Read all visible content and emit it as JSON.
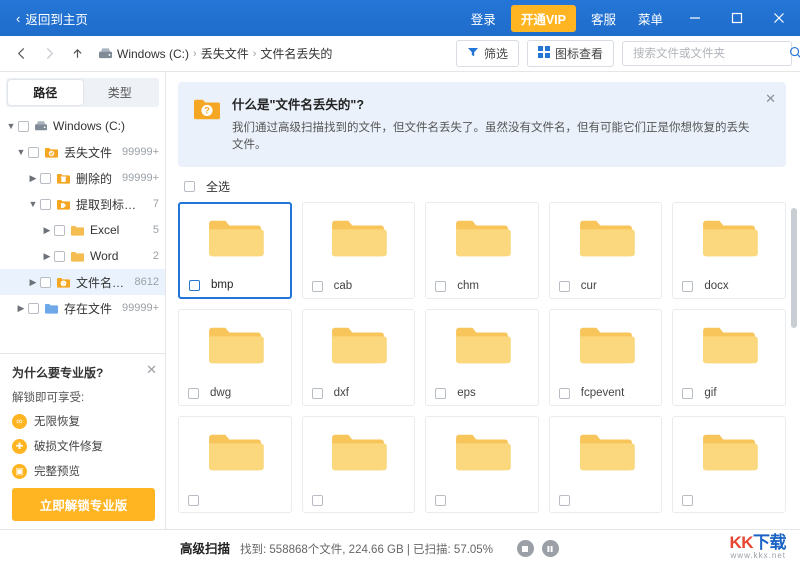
{
  "titlebar": {
    "back_label": "返回到主页",
    "back_icon": "chevron-left-icon",
    "menu": [
      {
        "label": "登录",
        "name": "login"
      },
      {
        "label": "客服",
        "name": "support"
      },
      {
        "label": "菜单",
        "name": "menu"
      }
    ],
    "vip_label": "开通VIP",
    "window_buttons": {
      "minimize": "minimize-icon",
      "maximize": "maximize-icon",
      "close": "close-icon"
    },
    "bg_color": "#2476d6",
    "vip_color": "#ffb422"
  },
  "navbar": {
    "back_icon": "arrow-left-icon",
    "forward_icon": "arrow-right-icon",
    "up_icon": "arrow-up-icon",
    "breadcrumb": [
      "Windows (C:)",
      "丢失文件",
      "文件名丢失的"
    ],
    "filter_label": "筛选",
    "view_label": "图标查看",
    "search_placeholder": "搜索文件或文件夹",
    "search_value": ""
  },
  "sidebar": {
    "tabs": [
      {
        "label": "路径",
        "active": true
      },
      {
        "label": "类型",
        "active": false
      }
    ],
    "tree": [
      {
        "label": "Windows (C:)",
        "count": "",
        "depth": 0,
        "caret": "▼",
        "icon": "drive-icon",
        "selected": false
      },
      {
        "label": "丢失文件",
        "count": "99999+",
        "depth": 1,
        "caret": "▼",
        "icon": "folder-orange-icon",
        "selected": false
      },
      {
        "label": "删除的",
        "count": "99999+",
        "depth": 2,
        "caret": "▶",
        "icon": "folder-recycle-icon",
        "selected": false
      },
      {
        "label": "提取到标签的",
        "count": "7",
        "depth": 2,
        "caret": "▼",
        "icon": "folder-tag-icon",
        "selected": false
      },
      {
        "label": "Excel",
        "count": "5",
        "depth": 3,
        "caret": "▶",
        "icon": "folder-icon",
        "selected": false
      },
      {
        "label": "Word",
        "count": "2",
        "depth": 3,
        "caret": "▶",
        "icon": "folder-icon",
        "selected": false
      },
      {
        "label": "文件名丢失的",
        "count": "8612",
        "depth": 2,
        "caret": "▶",
        "icon": "folder-question-icon",
        "selected": true
      },
      {
        "label": "存在文件",
        "count": "99999+",
        "depth": 1,
        "caret": "▶",
        "icon": "folder-blue-icon",
        "selected": false
      }
    ],
    "promo": {
      "title": "为什么要专业版?",
      "subtitle": "解锁即可享受:",
      "items": [
        {
          "label": "无限恢复",
          "icon": "unlimited-icon"
        },
        {
          "label": "破损文件修复",
          "icon": "repair-icon"
        },
        {
          "label": "完整预览",
          "icon": "preview-icon"
        }
      ],
      "button_label": "立即解锁专业版",
      "close_icon": "close-icon"
    }
  },
  "notice": {
    "icon": "folder-question-icon",
    "title": "什么是\"文件名丢失的\"?",
    "text": "我们通过高级扫描找到的文件，但文件名丢失了。虽然没有文件名，但有可能它们正是你想恢复的丢失文件。",
    "close_icon": "close-icon"
  },
  "content": {
    "select_all_label": "全选",
    "items": [
      {
        "label": "bmp",
        "selected": true
      },
      {
        "label": "cab",
        "selected": false
      },
      {
        "label": "chm",
        "selected": false
      },
      {
        "label": "cur",
        "selected": false
      },
      {
        "label": "docx",
        "selected": false
      },
      {
        "label": "dwg",
        "selected": false
      },
      {
        "label": "dxf",
        "selected": false
      },
      {
        "label": "eps",
        "selected": false
      },
      {
        "label": "fcpevent",
        "selected": false
      },
      {
        "label": "gif",
        "selected": false
      },
      {
        "label": "",
        "selected": false
      },
      {
        "label": "",
        "selected": false
      },
      {
        "label": "",
        "selected": false
      },
      {
        "label": "",
        "selected": false
      },
      {
        "label": "",
        "selected": false
      }
    ]
  },
  "statusbar": {
    "title": "高级扫描",
    "found_label": "找到: 558868个文件, 224.66 GB | 已扫描: 57.05%",
    "stop_icon": "stop-icon",
    "pause_icon": "pause-icon"
  },
  "watermark": {
    "main_kk": "KK",
    "main_rest": "下载",
    "sub": "www.kkx.net"
  }
}
